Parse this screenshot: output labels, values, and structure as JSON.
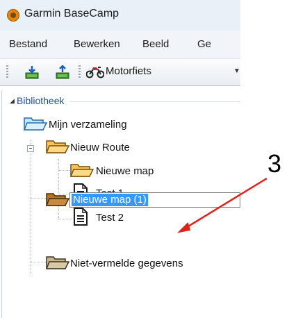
{
  "window": {
    "title": "Garmin BaseCamp"
  },
  "menu": {
    "items": [
      "Bestand",
      "Bewerken",
      "Beeld",
      "Ge"
    ]
  },
  "toolbar": {
    "profile_value": "Motorfiets"
  },
  "library": {
    "root_label": "Bibliotheek",
    "my_collection": "Mijn verzameling",
    "nodes": [
      "Nieuw Route",
      "Nieuwe map",
      "Test 1",
      "Test 2"
    ],
    "editing_value": "Nieuwe map (1)",
    "unlisted": "Niet-vermelde gegevens"
  },
  "annotation": {
    "number": "3",
    "color": "#e0221a"
  },
  "colors": {
    "selection": "#3399ff",
    "link": "#1f4f9c",
    "folder": "#f3b23a"
  }
}
